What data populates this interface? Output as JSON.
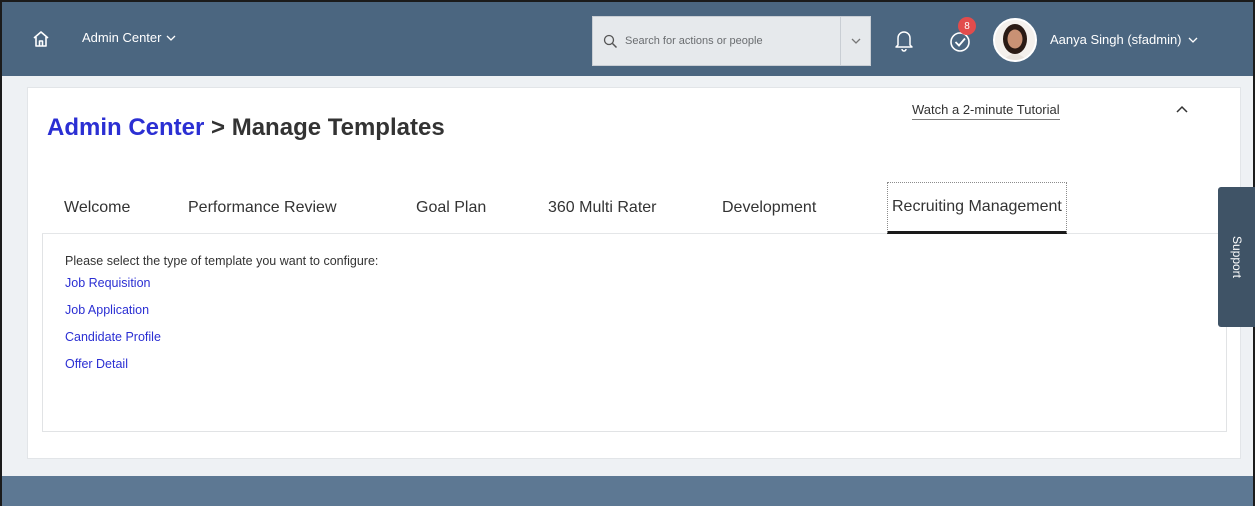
{
  "shell": {
    "app_menu_label": "Admin Center",
    "search_placeholder": "Search for actions or people",
    "notification_count": "8",
    "user_name": "Aanya Singh (sfadmin)",
    "bar_color": "#4b6680"
  },
  "header": {
    "breadcrumb_link": "Admin Center",
    "breadcrumb_separator": " > ",
    "page_title": "Manage Templates",
    "tutorial_link": "Watch a 2-minute Tutorial"
  },
  "tabs": [
    {
      "label": "Welcome",
      "active": false
    },
    {
      "label": "Performance Review",
      "active": false
    },
    {
      "label": "Goal Plan",
      "active": false
    },
    {
      "label": "360 Multi Rater",
      "active": false
    },
    {
      "label": "Development",
      "active": false
    },
    {
      "label": "Recruiting Management",
      "active": true
    }
  ],
  "content": {
    "prompt": "Please select the type of template you want to configure:",
    "links": [
      "Job Requisition",
      "Job Application",
      "Candidate Profile",
      "Offer Detail"
    ]
  },
  "support_tab": "Support",
  "icons": {
    "home": "home-icon",
    "search": "search-icon",
    "bell": "bell-icon",
    "todo": "todo-check-icon",
    "collapse": "chevron-up-icon"
  }
}
